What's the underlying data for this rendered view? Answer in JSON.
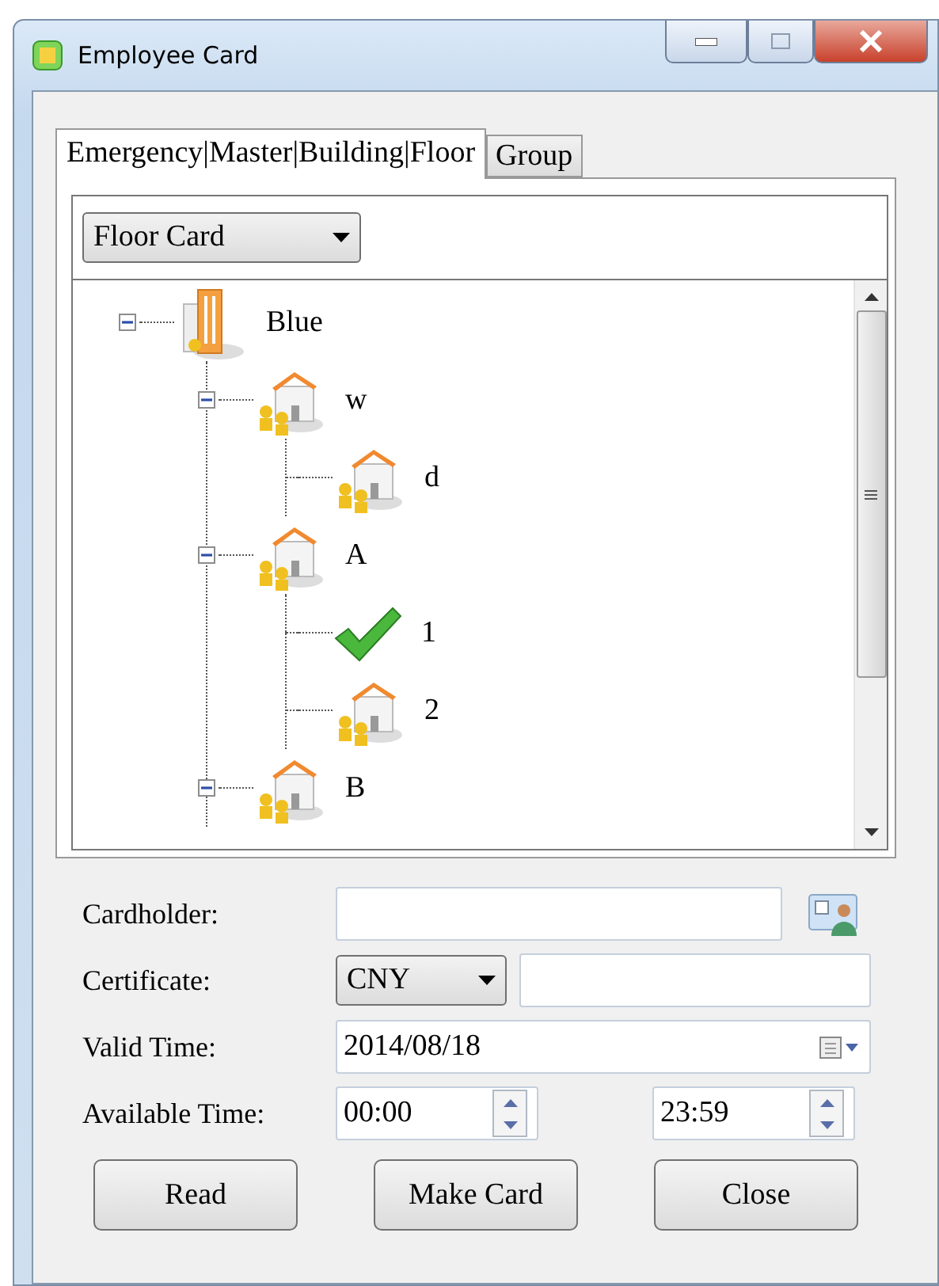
{
  "window": {
    "title": "Employee Card"
  },
  "tabs": [
    {
      "label": "Emergency|Master|Building|Floor",
      "selected": true
    },
    {
      "label": "Group",
      "selected": false
    }
  ],
  "card_type": {
    "value": "Floor Card"
  },
  "tree": [
    {
      "label": "Blue",
      "kind": "tower",
      "expanded": true,
      "children": [
        {
          "label": "w",
          "kind": "building",
          "expanded": true,
          "children": [
            {
              "label": "d",
              "kind": "building"
            }
          ]
        },
        {
          "label": "A",
          "kind": "building",
          "expanded": true,
          "children": [
            {
              "label": "1",
              "kind": "check"
            },
            {
              "label": "2",
              "kind": "building"
            }
          ]
        },
        {
          "label": "B",
          "kind": "building",
          "expanded": true
        }
      ]
    }
  ],
  "form": {
    "cardholder": {
      "label": "Cardholder:"
    },
    "certificate": {
      "label": "Certificate:",
      "type": "CNY"
    },
    "valid_time": {
      "label": "Valid Time:",
      "value": "2014/08/18"
    },
    "available_time": {
      "label": "Available Time:",
      "start": "00:00",
      "end": "23:59"
    }
  },
  "buttons": [
    "Read",
    "Make Card",
    "Close"
  ]
}
